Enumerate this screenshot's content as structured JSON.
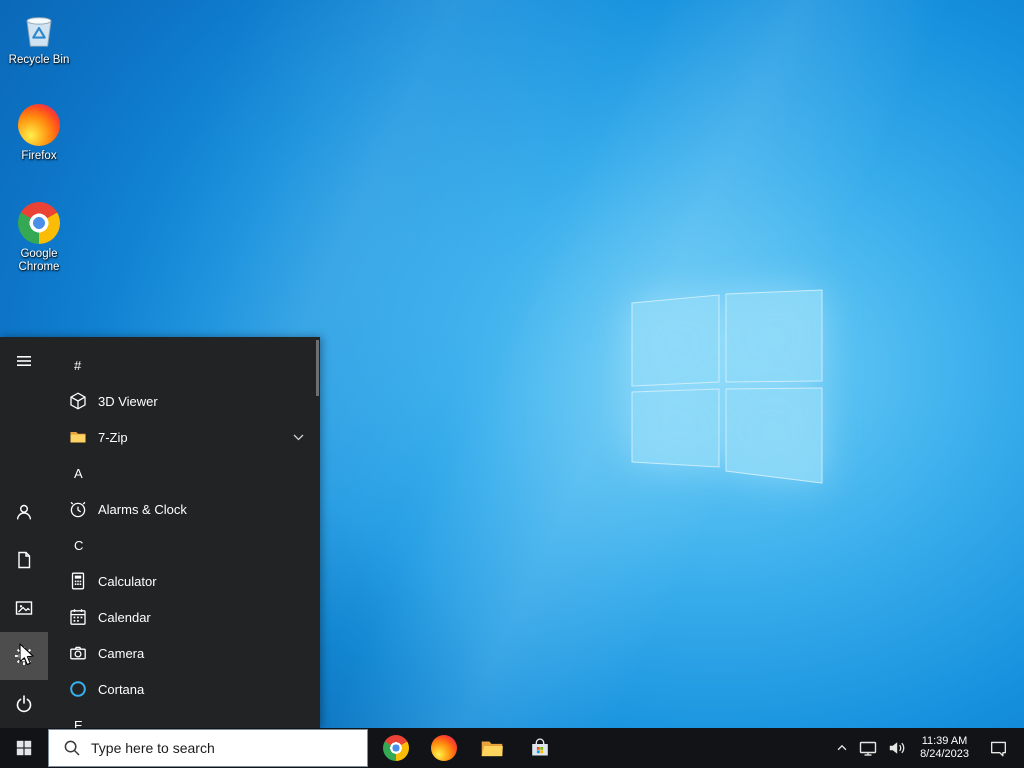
{
  "wallpaper": {
    "logo_icon": "windows-logo"
  },
  "desktop": {
    "icons": [
      {
        "name": "recycle-bin",
        "icon": "recycle-bin-icon",
        "label": "Recycle Bin"
      },
      {
        "name": "firefox",
        "icon": "firefox-icon",
        "label": "Firefox"
      },
      {
        "name": "google-chrome",
        "icon": "chrome-icon",
        "label": "Google Chrome"
      }
    ]
  },
  "start_menu": {
    "rail": [
      {
        "icon": "hamburger-menu-icon"
      },
      {
        "icon": "user-account-icon"
      },
      {
        "icon": "documents-icon"
      },
      {
        "icon": "pictures-icon"
      },
      {
        "icon": "settings-gear-icon",
        "highlighted": true
      },
      {
        "icon": "power-icon"
      }
    ],
    "rows": [
      {
        "type": "header",
        "label": "#"
      },
      {
        "type": "app",
        "label": "3D Viewer",
        "icon": "3d-viewer-icon"
      },
      {
        "type": "app",
        "label": "7-Zip",
        "icon": "folder-icon",
        "chevron": "chevron-down-icon"
      },
      {
        "type": "header",
        "label": "A"
      },
      {
        "type": "app",
        "label": "Alarms & Clock",
        "icon": "alarm-clock-icon"
      },
      {
        "type": "header",
        "label": "C"
      },
      {
        "type": "app",
        "label": "Calculator",
        "icon": "calculator-icon"
      },
      {
        "type": "app",
        "label": "Calendar",
        "icon": "calendar-icon"
      },
      {
        "type": "app",
        "label": "Camera",
        "icon": "camera-icon"
      },
      {
        "type": "app",
        "label": "Cortana",
        "icon": "cortana-icon"
      },
      {
        "type": "header",
        "label": "E"
      }
    ]
  },
  "taskbar": {
    "start": {
      "icon": "windows-flag-icon"
    },
    "search": {
      "icon": "search-icon",
      "placeholder": "Type here to search"
    },
    "pinned": [
      {
        "icon": "chrome-icon"
      },
      {
        "icon": "firefox-icon"
      },
      {
        "icon": "file-explorer-icon"
      },
      {
        "icon": "microsoft-store-icon"
      }
    ],
    "tray": {
      "chevron": "chevron-up-icon",
      "network": "network-display-icon",
      "volume": "speaker-icon",
      "time": "11:39 AM",
      "date": "8/24/2023",
      "action_center": "action-center-icon"
    }
  },
  "cursor": {
    "icon": "arrow-cursor-icon"
  },
  "colors": {
    "accent": "#0078d7",
    "taskbar_bg": "#111317",
    "start_menu_bg": "#222325",
    "rail_highlight": "#4d4d4d",
    "wallpaper_center": "#72d2f8",
    "wallpaper_edge": "#0a63b2",
    "folder_yellow": "#ffd363",
    "cortana_ring": "#38b2ee"
  }
}
